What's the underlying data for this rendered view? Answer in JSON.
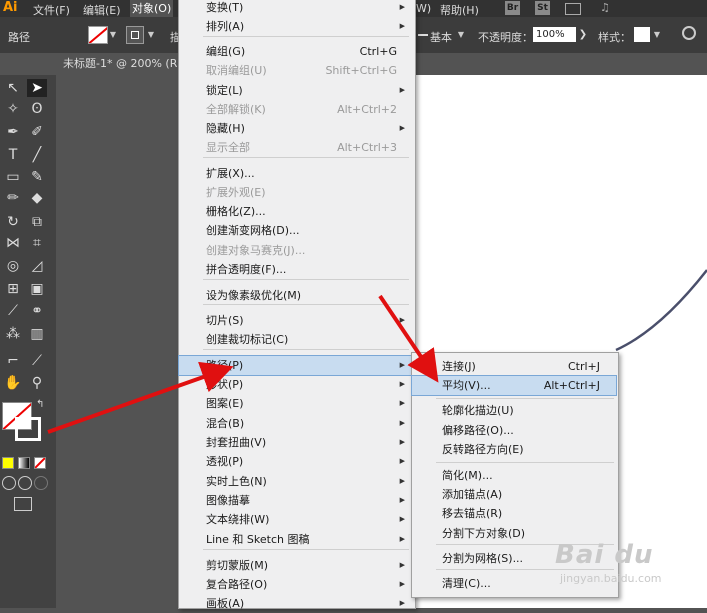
{
  "menubar": {
    "logo": "Ai",
    "items": [
      "文件(F)",
      "编辑(E)",
      "对象(O)",
      "W)",
      "帮助(H)"
    ],
    "app_icons": [
      "Br",
      "St"
    ]
  },
  "control_bar": {
    "path_label": "路径",
    "partial_label": "描",
    "stroke_style": "基本",
    "opacity_label": "不透明度：",
    "opacity_value": "100%",
    "style_label": "样式："
  },
  "document_tab": "未标题-1* @ 200% (R(",
  "object_menu": {
    "items": [
      {
        "label": "变换(T)",
        "shortcut": "",
        "submenu": true,
        "disabled": false
      },
      {
        "label": "排列(A)",
        "shortcut": "",
        "submenu": true,
        "disabled": false
      },
      {
        "label": "编组(G)",
        "shortcut": "Ctrl+G",
        "submenu": false,
        "disabled": false
      },
      {
        "label": "取消编组(U)",
        "shortcut": "Shift+Ctrl+G",
        "submenu": false,
        "disabled": true
      },
      {
        "label": "锁定(L)",
        "shortcut": "",
        "submenu": true,
        "disabled": false
      },
      {
        "label": "全部解锁(K)",
        "shortcut": "Alt+Ctrl+2",
        "submenu": false,
        "disabled": true
      },
      {
        "label": "隐藏(H)",
        "shortcut": "",
        "submenu": true,
        "disabled": false
      },
      {
        "label": "显示全部",
        "shortcut": "Alt+Ctrl+3",
        "submenu": false,
        "disabled": true
      },
      {
        "label": "扩展(X)...",
        "shortcut": "",
        "submenu": false,
        "disabled": false
      },
      {
        "label": "扩展外观(E)",
        "shortcut": "",
        "submenu": false,
        "disabled": true
      },
      {
        "label": "栅格化(Z)...",
        "shortcut": "",
        "submenu": false,
        "disabled": false
      },
      {
        "label": "创建渐变网格(D)...",
        "shortcut": "",
        "submenu": false,
        "disabled": false
      },
      {
        "label": "创建对象马赛克(J)...",
        "shortcut": "",
        "submenu": false,
        "disabled": true
      },
      {
        "label": "拼合透明度(F)...",
        "shortcut": "",
        "submenu": false,
        "disabled": false
      },
      {
        "label": "设为像素级优化(M)",
        "shortcut": "",
        "submenu": false,
        "disabled": false
      },
      {
        "label": "切片(S)",
        "shortcut": "",
        "submenu": true,
        "disabled": false
      },
      {
        "label": "创建裁切标记(C)",
        "shortcut": "",
        "submenu": false,
        "disabled": false
      },
      {
        "label": "路径(P)",
        "shortcut": "",
        "submenu": true,
        "disabled": false
      },
      {
        "label": "形状(P)",
        "shortcut": "",
        "submenu": true,
        "disabled": false
      },
      {
        "label": "图案(E)",
        "shortcut": "",
        "submenu": true,
        "disabled": false
      },
      {
        "label": "混合(B)",
        "shortcut": "",
        "submenu": true,
        "disabled": false
      },
      {
        "label": "封套扭曲(V)",
        "shortcut": "",
        "submenu": true,
        "disabled": false
      },
      {
        "label": "透视(P)",
        "shortcut": "",
        "submenu": true,
        "disabled": false
      },
      {
        "label": "实时上色(N)",
        "shortcut": "",
        "submenu": true,
        "disabled": false
      },
      {
        "label": "图像描摹",
        "shortcut": "",
        "submenu": true,
        "disabled": false
      },
      {
        "label": "文本绕排(W)",
        "shortcut": "",
        "submenu": true,
        "disabled": false
      },
      {
        "label": "Line 和 Sketch 图稿",
        "shortcut": "",
        "submenu": true,
        "disabled": false
      },
      {
        "label": "剪切蒙版(M)",
        "shortcut": "",
        "submenu": true,
        "disabled": false
      },
      {
        "label": "复合路径(O)",
        "shortcut": "",
        "submenu": true,
        "disabled": false
      },
      {
        "label": "画板(A)",
        "shortcut": "",
        "submenu": true,
        "disabled": false
      }
    ]
  },
  "path_submenu": {
    "items": [
      {
        "label": "连接(J)",
        "shortcut": "Ctrl+J"
      },
      {
        "label": "平均(V)...",
        "shortcut": "Alt+Ctrl+J"
      },
      {
        "label": "轮廓化描边(U)",
        "shortcut": ""
      },
      {
        "label": "偏移路径(O)...",
        "shortcut": ""
      },
      {
        "label": "反转路径方向(E)",
        "shortcut": ""
      },
      {
        "label": "简化(M)...",
        "shortcut": ""
      },
      {
        "label": "添加锚点(A)",
        "shortcut": ""
      },
      {
        "label": "移去锚点(R)",
        "shortcut": ""
      },
      {
        "label": "分割下方对象(D)",
        "shortcut": ""
      },
      {
        "label": "分割为网格(S)...",
        "shortcut": ""
      },
      {
        "label": "清理(C)...",
        "shortcut": ""
      }
    ]
  },
  "watermark": {
    "brand": "Bai du",
    "sub": "jingyan.baidu.com"
  },
  "colors": {
    "menu_highlight": "#c8dcf0",
    "annotation_arrow": "#e01010",
    "menu_bg": "#efeff0"
  }
}
